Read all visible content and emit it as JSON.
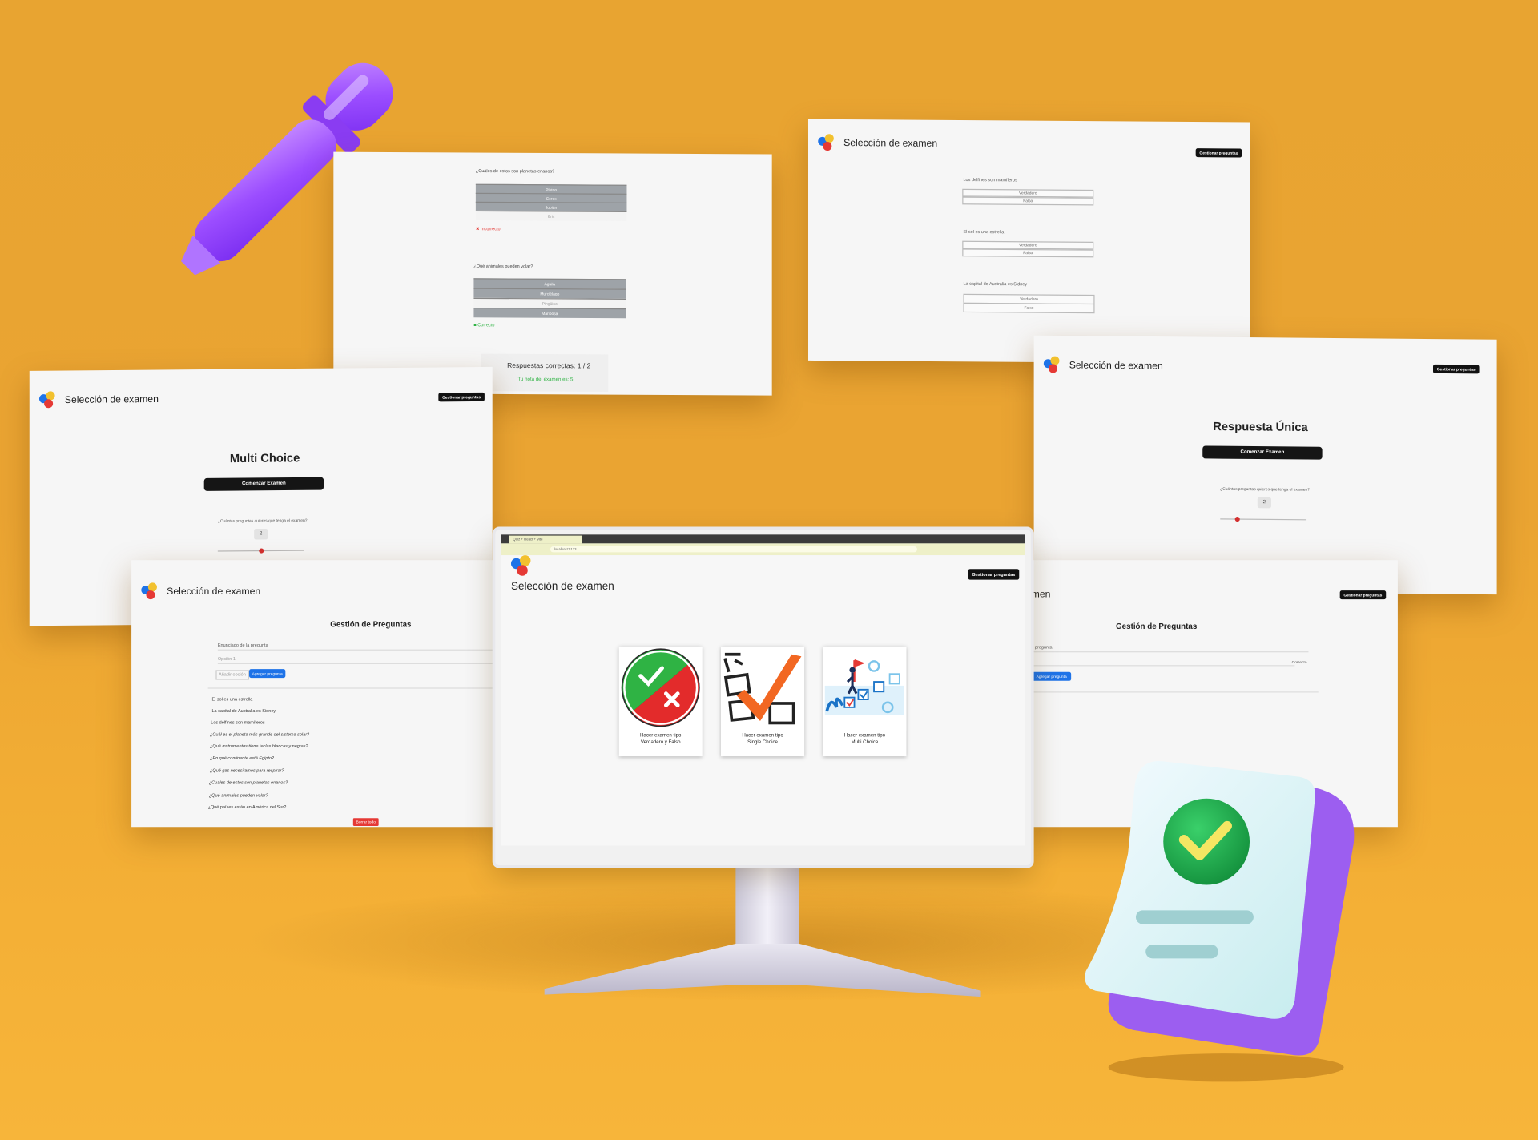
{
  "app": {
    "title": "Selección de examen",
    "manage_button": "Gestionar preguntas"
  },
  "panel_results": {
    "q1": "¿Cuáles de estos son planetas enanos?",
    "q1_options": [
      "Pluton",
      "Ceres",
      "Jupiter",
      "Eris"
    ],
    "q1_status": "Incorrecto",
    "q2": "¿Qué animales pueden volar?",
    "q2_options": [
      "Águila",
      "Murciélago",
      "Pingüino",
      "Mariposa"
    ],
    "q2_status": "Correcto",
    "score_label": "Respuestas correctas: 1 / 2",
    "grade_label": "Tu nota del examen es: 5"
  },
  "panel_truefalse": {
    "questions": [
      {
        "text": "Los delfines son mamíferos",
        "options": [
          "Verdadero",
          "Falso"
        ]
      },
      {
        "text": "El sol es una estrella",
        "options": [
          "Verdadero",
          "Falso"
        ]
      },
      {
        "text": "La capital de Australia es Sidney",
        "options": [
          "Verdadero",
          "Falso"
        ]
      }
    ]
  },
  "panel_multi": {
    "heading": "Multi Choice",
    "start_button": "Comenzar Examen",
    "length_question": "¿Cuántas preguntas quieres que tenga el examen?",
    "count": "2",
    "slider_value": 0.5
  },
  "panel_single": {
    "heading": "Respuesta Única",
    "start_button": "Comenzar Examen",
    "length_question": "¿Cuántas preguntas quieres que tenga el examen?",
    "count": "2",
    "slider_value": 0.2
  },
  "panel_manage_left": {
    "heading": "Gestión de Preguntas",
    "statement_placeholder": "Enunciado de la pregunta",
    "option_placeholder": "Opción 1",
    "add_option_placeholder": "Añadir opción",
    "add_question_button": "Agregar pregunta",
    "questions": [
      "El sol es una estrella",
      "La capital de Australia es Sidney",
      "Los delfines son mamíferos",
      "¿Cuál es el planeta más grande del sistema solar?",
      "¿Qué instrumentos tiene teclas blancas y negras?",
      "¿En qué continente está Egipto?",
      "¿Qué gas necesitamos para respirar?",
      "¿Cuáles de estos son planetas enanos?",
      "¿Qué animales pueden volar?",
      "¿Qué países están en América del Sur?"
    ],
    "delete_all_button": "Borrar todo"
  },
  "panel_manage_right": {
    "title_fragment": "amen",
    "heading": "Gestión de Preguntas",
    "statement_fragment": "de la pregunta",
    "correct_label": "Correcto",
    "add_question_button": "Agregar pregunta"
  },
  "monitor": {
    "browser_tab": "Quiz + React + Vite",
    "url": "localhost:5173",
    "cards": [
      {
        "label_line1": "Hacer examen tipo",
        "label_line2": "Verdadero y Falso",
        "icon": "check-cross-icon"
      },
      {
        "label_line1": "Hacer examen tipo",
        "label_line2": "Single Choice",
        "icon": "checkbox-list-icon"
      },
      {
        "label_line1": "Hacer examen tipo",
        "label_line2": "Multi Choice",
        "icon": "multi-choice-illustration"
      }
    ]
  },
  "colors": {
    "background": "#eaa432",
    "accent_purple": "#9b5de5",
    "correct_green": "#2fb344",
    "incorrect_red": "#e53935",
    "primary_blue": "#1e73e8"
  }
}
